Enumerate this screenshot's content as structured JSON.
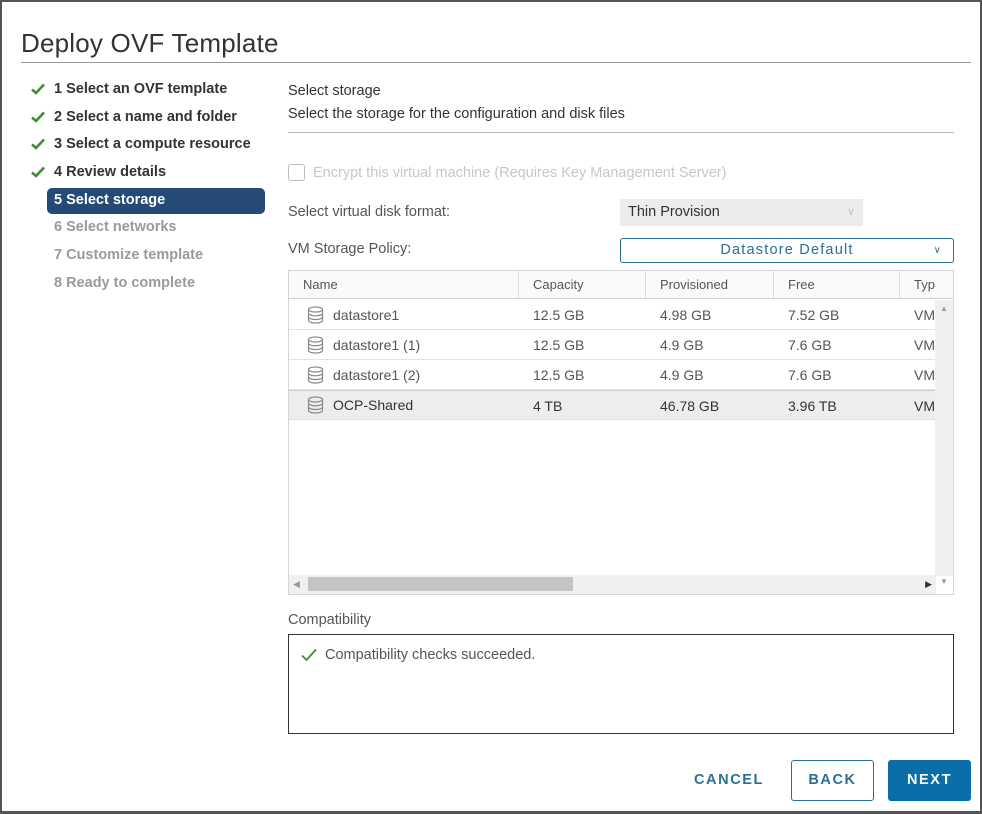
{
  "dialog": {
    "title": "Deploy OVF Template"
  },
  "steps": [
    {
      "label": "1 Select an OVF template",
      "state": "completed"
    },
    {
      "label": "2 Select a name and folder",
      "state": "completed"
    },
    {
      "label": "3 Select a compute resource",
      "state": "completed"
    },
    {
      "label": "4 Review details",
      "state": "completed"
    },
    {
      "label": "5 Select storage",
      "state": "current"
    },
    {
      "label": "6 Select networks",
      "state": "pending"
    },
    {
      "label": "7 Customize template",
      "state": "pending"
    },
    {
      "label": "8 Ready to complete",
      "state": "pending"
    }
  ],
  "main": {
    "title": "Select storage",
    "subtitle": "Select the storage for the configuration and disk files",
    "encrypt": {
      "label": "Encrypt this virtual machine (Requires Key Management Server)",
      "checked": false,
      "disabled": true
    },
    "disk_format": {
      "label": "Select virtual disk format:",
      "value": "Thin Provision",
      "disabled": true
    },
    "storage_policy": {
      "label": "VM Storage Policy:",
      "value": "Datastore Default"
    },
    "grid": {
      "columns": [
        "Name",
        "Capacity",
        "Provisioned",
        "Free",
        "Typ"
      ],
      "rows": [
        {
          "name": "datastore1",
          "capacity": "12.5 GB",
          "provisioned": "4.98 GB",
          "free": "7.52 GB",
          "type": "VM",
          "selected": false
        },
        {
          "name": "datastore1 (1)",
          "capacity": "12.5 GB",
          "provisioned": "4.9 GB",
          "free": "7.6 GB",
          "type": "VM",
          "selected": false
        },
        {
          "name": "datastore1 (2)",
          "capacity": "12.5 GB",
          "provisioned": "4.9 GB",
          "free": "7.6 GB",
          "type": "VM",
          "selected": false
        },
        {
          "name": "OCP-Shared",
          "capacity": "4 TB",
          "provisioned": "46.78 GB",
          "free": "3.96 TB",
          "type": "VM",
          "selected": true
        }
      ],
      "row_icon": "datastore-icon"
    },
    "compatibility": {
      "label": "Compatibility",
      "message": "Compatibility checks succeeded.",
      "status_icon": "check-icon"
    }
  },
  "footer": {
    "cancel_label": "CANCEL",
    "back_label": "BACK",
    "next_label": "NEXT"
  },
  "colors": {
    "accent": "#0a6ea8",
    "current_step": "#254a75",
    "success": "#3c8d2f"
  }
}
